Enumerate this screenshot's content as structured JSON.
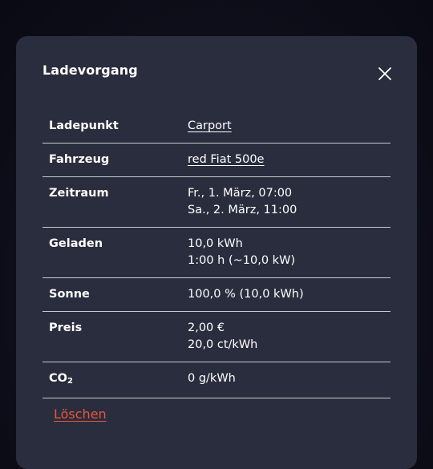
{
  "dialog": {
    "title": "Ladevorgang",
    "close_icon": "close-icon",
    "delete_label": "Löschen"
  },
  "rows": {
    "ladepunkt": {
      "label": "Ladepunkt",
      "value": "Carport"
    },
    "fahrzeug": {
      "label": "Fahrzeug",
      "value": "red Fiat 500e"
    },
    "zeitraum": {
      "label": "Zeitraum",
      "start": "Fr., 1. März, 07:00",
      "end": "Sa., 2. März, 11:00"
    },
    "geladen": {
      "label": "Geladen",
      "energy": "10,0 kWh",
      "duration": "1:00 h (~10,0 kW)"
    },
    "sonne": {
      "label": "Sonne",
      "value": "100,0 % (10,0 kWh)"
    },
    "preis": {
      "label": "Preis",
      "total": "2,00 €",
      "per_kwh": "20,0 ct/kWh"
    },
    "co2": {
      "label_main": "CO",
      "label_sub": "2",
      "value": "0 g/kWh"
    }
  },
  "colors": {
    "modal_bg": "#2a2d3d",
    "delete_accent": "#e8553d",
    "divider": "#c7c9d1"
  }
}
